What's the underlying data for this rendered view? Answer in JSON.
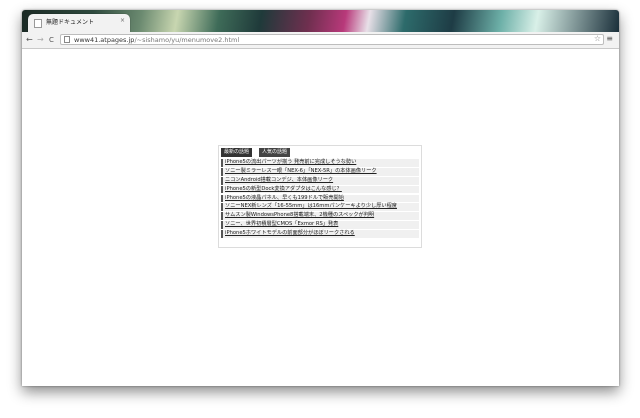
{
  "browser": {
    "tab_title": "無題ドキュメント",
    "tab_close": "×",
    "url_host": "www41.atpages.jp",
    "url_path": "/~sishamo/yu/menumove2.html"
  },
  "widget": {
    "tabs": [
      "最新の話題",
      "人気の話題"
    ],
    "items": [
      "iPhone5の流出パーツが揃う 発売前に完成しそうな勢い",
      "ソニー製ミラーレス一眼「NEX-6」「NEX-5R」の本体画像リーク",
      "ニコンAndroid搭載コンデジ、本体画像リーク",
      "iPhone5の新型Dock変換アダプタはこんな感じ？",
      "iPhone5の液晶パネル、早くも199ドルで販売開始",
      "ソニーNEX新レンズ「16-55mm」は16mmパンケーキより少し厚い程度",
      "サムスン製WindowsPhone8搭載端末、2機種のスペックが判明",
      "ソニー、世界初積層型CMOS「Exmor RS」発表",
      "iPhone5ホワイトモデルの前面部分がほぼリークされる"
    ]
  },
  "icons": {
    "back": "←",
    "forward": "→",
    "reload": "C",
    "star": "☆",
    "menu": "≡"
  }
}
